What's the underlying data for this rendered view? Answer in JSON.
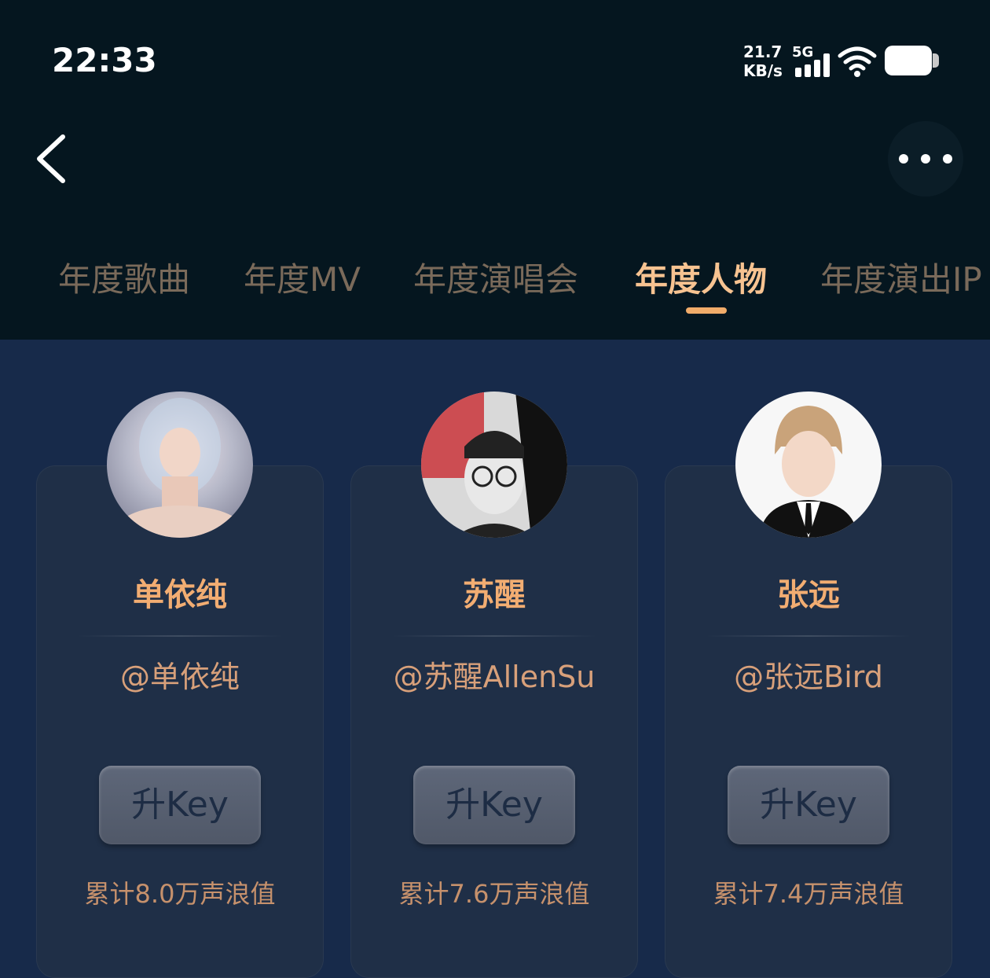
{
  "status_bar": {
    "time": "22:33",
    "net_speed_value": "21.7",
    "net_speed_unit": "KB/s",
    "network_type": "5G",
    "wifi_icon": "wifi-icon",
    "battery_icon": "battery-icon"
  },
  "header": {
    "back_icon": "chevron-left-icon",
    "more_icon": "more-dots-icon"
  },
  "tabs": [
    {
      "label": "年度歌曲",
      "active": false
    },
    {
      "label": "年度MV",
      "active": false
    },
    {
      "label": "年度演唱会",
      "active": false
    },
    {
      "label": "年度人物",
      "active": true
    },
    {
      "label": "年度演出IP",
      "active": false
    }
  ],
  "cards": [
    {
      "name": "单依纯",
      "handle": "@单依纯",
      "button_label": "升Key",
      "score": "累计8.0万声浪值"
    },
    {
      "name": "苏醒",
      "handle": "@苏醒AllenSu",
      "button_label": "升Key",
      "score": "累计7.6万声浪值"
    },
    {
      "name": "张远",
      "handle": "@张远Bird",
      "button_label": "升Key",
      "score": "累计7.4万声浪值"
    }
  ],
  "colors": {
    "header_bg": "#05161f",
    "page_bg": "#172a4a",
    "card_bg": "#1f2f47",
    "accent": "#f2ad72",
    "tab_inactive": "#7a6a5a"
  }
}
